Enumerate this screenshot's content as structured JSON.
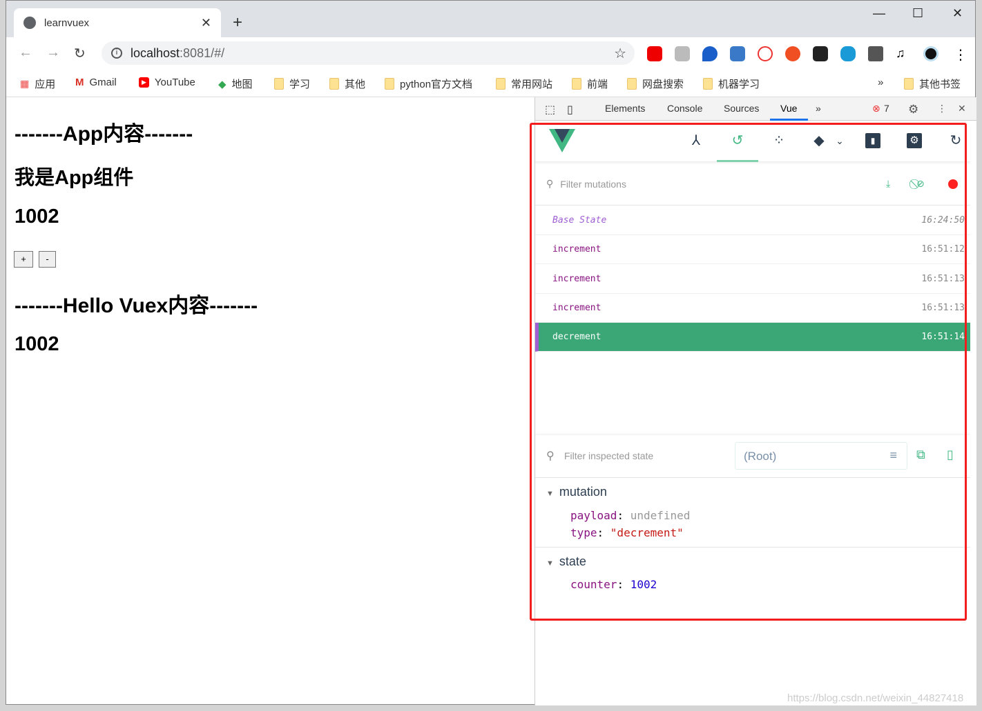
{
  "browser": {
    "tab_title": "learnvuex",
    "url_host": "localhost",
    "url_rest": ":8081/#/",
    "bookmarks": [
      "应用",
      "Gmail",
      "YouTube",
      "地图",
      "学习",
      "其他",
      "python官方文档",
      "常用网站",
      "前端",
      "网盘搜索",
      "机器学习"
    ],
    "more": "»",
    "other_bookmarks": "其他书签"
  },
  "page": {
    "h_app": "-------App内容-------",
    "h_comp": "我是App组件",
    "counter1": "1002",
    "plus": "+",
    "minus": "-",
    "h_vuex": "-------Hello Vuex内容-------",
    "counter2": "1002"
  },
  "devtools": {
    "tabs": [
      "Elements",
      "Console",
      "Sources",
      "Vue"
    ],
    "active_tab": "Vue",
    "error_count": "7",
    "vue": {
      "filter_placeholder": "Filter mutations",
      "mutations": [
        {
          "name": "Base State",
          "time": "16:24:50"
        },
        {
          "name": "increment",
          "time": "16:51:12"
        },
        {
          "name": "increment",
          "time": "16:51:13"
        },
        {
          "name": "increment",
          "time": "16:51:13"
        },
        {
          "name": "decrement",
          "time": "16:51:14"
        }
      ],
      "inspect_placeholder": "Filter inspected state",
      "root_label": "(Root)",
      "mutation_section": "mutation",
      "payload_key": "payload",
      "payload_val": "undefined",
      "type_key": "type",
      "type_val": "\"decrement\"",
      "state_section": "state",
      "counter_key": "counter",
      "counter_val": "1002"
    }
  },
  "watermark": "https://blog.csdn.net/weixin_44827418",
  "colors": {
    "accent": "#3ba776",
    "highlight_box": "#f21d1d"
  }
}
